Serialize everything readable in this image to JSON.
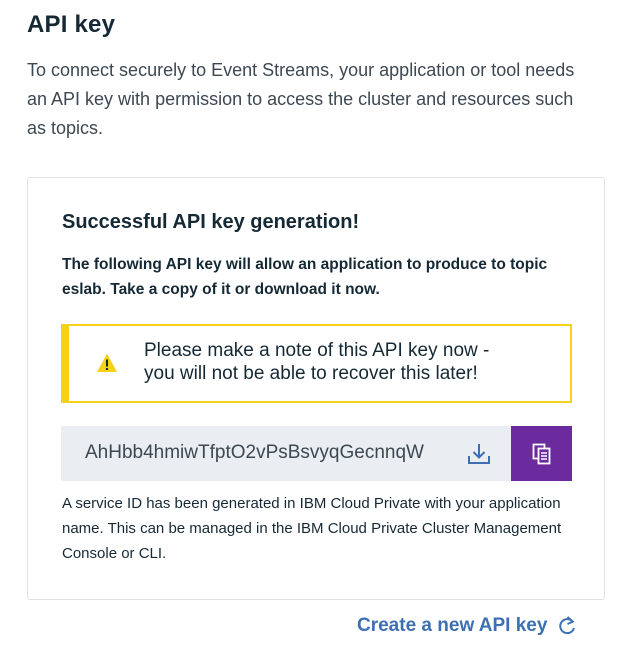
{
  "header": {
    "title": "API key",
    "description": "To connect securely to Event Streams, your application or tool needs an API key with permission to access the cluster and resources such as topics."
  },
  "card": {
    "heading": "Successful API key generation!",
    "subtext": "The following API key will allow an application to produce to topic eslab. Take a copy of it or download it now.",
    "warning": {
      "icon": "warning-triangle-icon",
      "line1": "Please make a note of this API key now -",
      "line2": "you will not be able to recover this later!"
    },
    "api_key": {
      "value": "AhHbb4hmiwTfptO2vPsBsvyqGecnnqW",
      "download_icon": "download-icon",
      "copy_icon": "copy-icon"
    },
    "service_note": "A service ID has been generated in IBM Cloud Private with your application name. This can be managed in the IBM Cloud Private Cluster Management Console or CLI."
  },
  "footer": {
    "create_link_label": "Create a new API key",
    "create_link_icon": "refresh-icon"
  },
  "colors": {
    "accent_link": "#3d70b2",
    "copy_button": "#6b2a9e",
    "warning_border": "#f4d21a",
    "key_field_bg": "#eaeef2"
  }
}
